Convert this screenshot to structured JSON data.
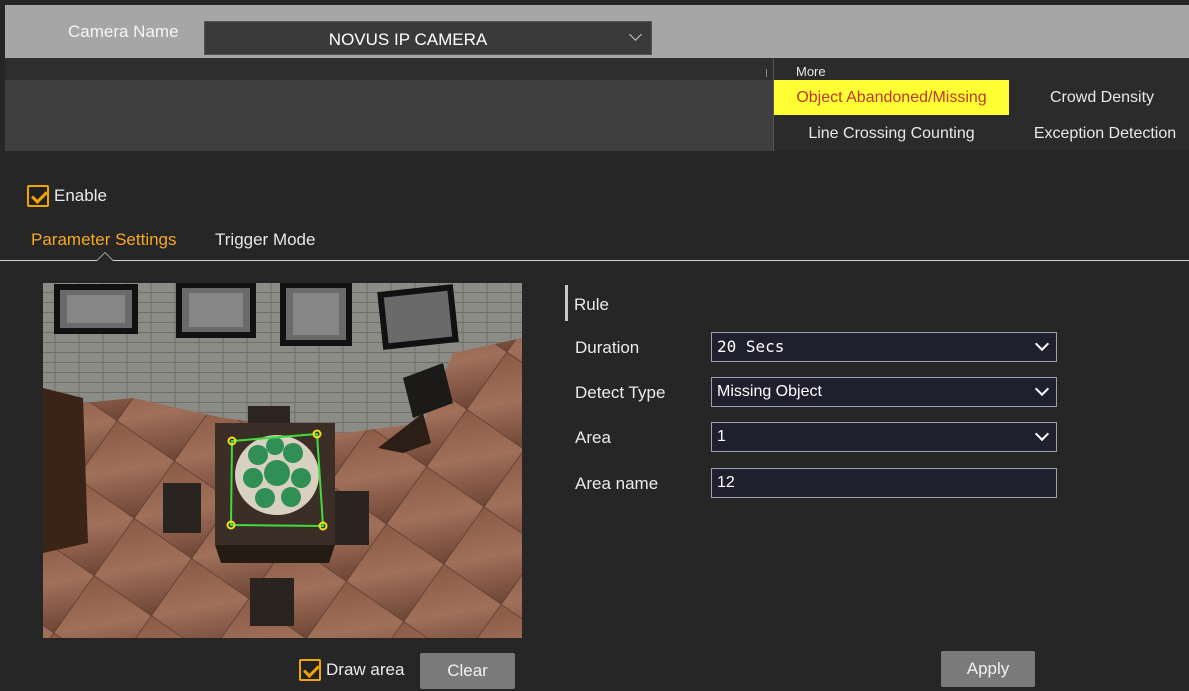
{
  "camera": {
    "label": "Camera Name",
    "value": "NOVUS IP CAMERA"
  },
  "more_menu": {
    "title": "More",
    "items": [
      {
        "label": "Object Abandoned/Missing",
        "active": true
      },
      {
        "label": "Crowd Density",
        "active": false
      },
      {
        "label": "Line Crossing Counting",
        "active": false
      },
      {
        "label": "Exception Detection",
        "active": false
      }
    ]
  },
  "enable": {
    "label": "Enable",
    "checked": true
  },
  "tabs": [
    {
      "label": "Parameter Settings",
      "active": true
    },
    {
      "label": "Trigger Mode",
      "active": false
    }
  ],
  "video_controls": {
    "draw_label": "Draw area",
    "draw_checked": true,
    "clear_label": "Clear"
  },
  "rule": {
    "title": "Rule",
    "fields": [
      {
        "label": "Duration",
        "value": "20 Secs",
        "type": "select"
      },
      {
        "label": "Detect Type",
        "value": "Missing Object",
        "type": "select"
      },
      {
        "label": "Area",
        "value": "1",
        "type": "select"
      },
      {
        "label": "Area name",
        "value": "12",
        "type": "text"
      }
    ]
  },
  "apply_label": "Apply",
  "colors": {
    "accent": "#f7a823",
    "active_bg": "#ffff33",
    "active_fg": "#c0392b",
    "roi": "#3fdc3f"
  }
}
